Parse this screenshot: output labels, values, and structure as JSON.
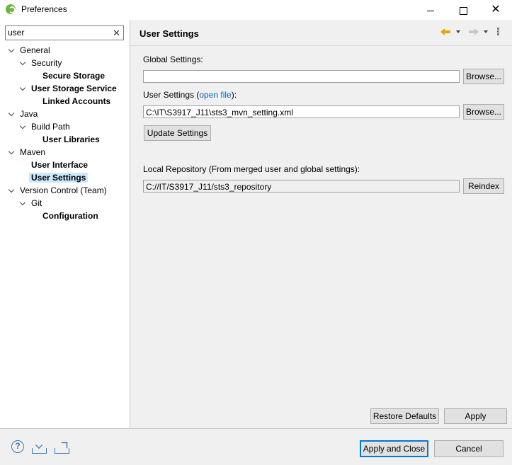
{
  "window": {
    "title": "Preferences",
    "minimize_icon": "minimize-icon",
    "maximize_icon": "maximize-icon",
    "close_glyph": "✕"
  },
  "filter": {
    "value": "user",
    "clear_glyph": "✕"
  },
  "tree": {
    "items": [
      {
        "label": "General",
        "level": 0,
        "expanded": true,
        "bold": false
      },
      {
        "label": "Security",
        "level": 1,
        "expanded": true,
        "bold": false
      },
      {
        "label": "Secure Storage",
        "level": 2,
        "bold": true
      },
      {
        "label": "User Storage Service",
        "level": 1,
        "expanded": true,
        "bold": true
      },
      {
        "label": "Linked Accounts",
        "level": 2,
        "bold": true
      },
      {
        "label": "Java",
        "level": 0,
        "expanded": true,
        "bold": false
      },
      {
        "label": "Build Path",
        "level": 1,
        "expanded": true,
        "bold": false
      },
      {
        "label": "User Libraries",
        "level": 2,
        "bold": true
      },
      {
        "label": "Maven",
        "level": 0,
        "expanded": true,
        "bold": false
      },
      {
        "label": "User Interface",
        "level": 1,
        "bold": true
      },
      {
        "label": "User Settings",
        "level": 1,
        "bold": true,
        "selected": true
      },
      {
        "label": "Version Control (Team)",
        "level": 0,
        "expanded": true,
        "bold": false
      },
      {
        "label": "Git",
        "level": 1,
        "expanded": true,
        "bold": false
      },
      {
        "label": "Configuration",
        "level": 2,
        "bold": true
      }
    ]
  },
  "page": {
    "title": "User Settings",
    "global_settings_label": "Global Settings:",
    "global_settings_value": "",
    "browse_label": "Browse...",
    "user_settings_label_prefix": "User Settings (",
    "open_file_link": "open file",
    "user_settings_label_suffix": "):",
    "user_settings_value": "C:\\IT\\S3917_J11\\sts3_mvn_setting.xml",
    "update_settings_label": "Update Settings",
    "local_repo_label": "Local Repository (From merged user and global settings):",
    "local_repo_value": "C://IT/S3917_J11/sts3_repository",
    "reindex_label": "Reindex",
    "restore_defaults_label": "Restore Defaults",
    "apply_label": "Apply"
  },
  "footer": {
    "help_glyph": "?",
    "apply_close_label": "Apply and Close",
    "cancel_label": "Cancel"
  },
  "colors": {
    "selection": "#cce8ff",
    "link": "#0066cc",
    "default_button_border": "#0078d7",
    "accent_icon": "#3a78b5"
  }
}
